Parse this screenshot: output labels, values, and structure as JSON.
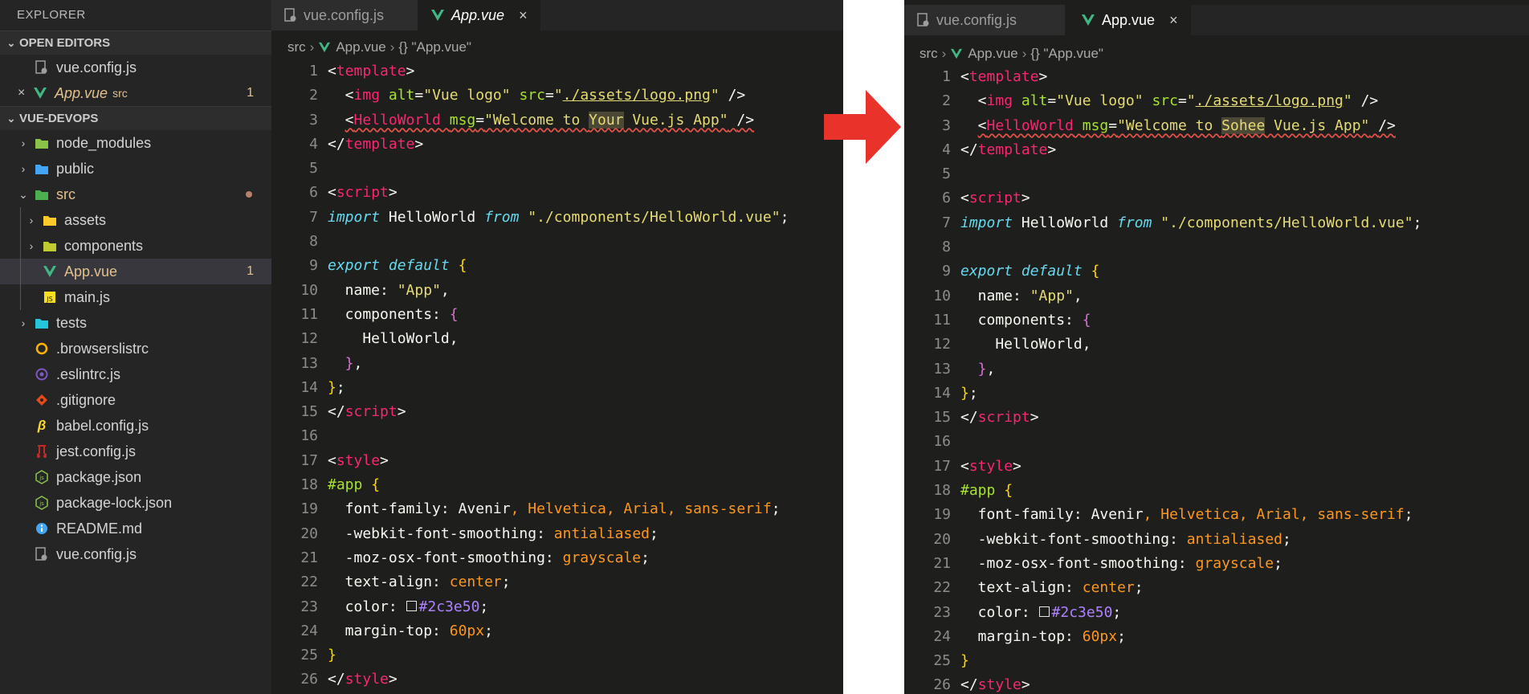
{
  "explorer": {
    "title": "EXPLORER",
    "open_editors": {
      "label": "OPEN EDITORS",
      "items": [
        {
          "name": "vue.config.js",
          "icon": "gear-file-icon"
        },
        {
          "name": "App.vue",
          "desc": "src",
          "badge": "1",
          "icon": "vue-icon"
        }
      ]
    },
    "project": {
      "label": "VUE-DEVOPS",
      "items": [
        {
          "name": "node_modules",
          "type": "folder",
          "color": "#8bc34a"
        },
        {
          "name": "public",
          "type": "folder",
          "color": "#42a5f5"
        },
        {
          "name": "src",
          "type": "folder",
          "color": "#4caf50"
        },
        {
          "name": "assets",
          "type": "folder",
          "color": "#ffca28"
        },
        {
          "name": "components",
          "type": "folder",
          "color": "#c0ca33"
        },
        {
          "name": "App.vue",
          "badge": "1"
        },
        {
          "name": "main.js"
        },
        {
          "name": "tests",
          "type": "folder",
          "color": "#26c6da"
        },
        {
          "name": ".browserslistrc"
        },
        {
          "name": ".eslintrc.js"
        },
        {
          "name": ".gitignore"
        },
        {
          "name": "babel.config.js"
        },
        {
          "name": "jest.config.js"
        },
        {
          "name": "package.json"
        },
        {
          "name": "package-lock.json"
        },
        {
          "name": "README.md"
        },
        {
          "name": "vue.config.js"
        }
      ]
    }
  },
  "left_editor": {
    "tabs": [
      {
        "label": "vue.config.js"
      },
      {
        "label": "App.vue",
        "close": "×"
      }
    ],
    "breadcrumb": [
      "src",
      "App.vue",
      "{} \"App.vue\""
    ],
    "welcome_word": "Your"
  },
  "right_editor": {
    "tabs": [
      {
        "label": "vue.config.js"
      },
      {
        "label": "App.vue",
        "close": "×"
      }
    ],
    "breadcrumb": [
      "src",
      "App.vue",
      "{} \"App.vue\""
    ],
    "welcome_word": "Sohee"
  },
  "code": {
    "line_numbers": [
      "1",
      "2",
      "3",
      "4",
      "5",
      "6",
      "7",
      "8",
      "9",
      "10",
      "11",
      "12",
      "13",
      "14",
      "15",
      "16",
      "17",
      "18",
      "19",
      "20",
      "21",
      "22",
      "23",
      "24",
      "25",
      "26"
    ],
    "template_open": "template",
    "img_tag": "img",
    "img_alt_attr": "alt",
    "img_alt_val": "\"Vue logo\"",
    "img_src_attr": "src",
    "img_src_val": "./assets/logo.png",
    "hello_tag": "HelloWorld",
    "msg_attr": "msg",
    "msg_before": "\"Welcome to ",
    "msg_after": " Vue.js App\"",
    "script_tag": "script",
    "import_kw": "import",
    "import_name": "HelloWorld",
    "from_kw": "from",
    "import_path": "\"./components/HelloWorld.vue\"",
    "export_kw": "export default",
    "name_prop": "name",
    "name_val": "\"App\"",
    "components_prop": "components",
    "hello_ref": "HelloWorld,",
    "style_tag": "style",
    "selector": "#app",
    "css": [
      {
        "prop": "font-family",
        "value_plain": "Avenir",
        "value_rest": ", Helvetica, Arial, sans-serif"
      },
      {
        "prop": "-webkit-font-smoothing",
        "value": "antialiased"
      },
      {
        "prop": "-moz-osx-font-smoothing",
        "value": "grayscale"
      },
      {
        "prop": "text-align",
        "value": "center"
      },
      {
        "prop": "color",
        "value": "#2c3e50"
      },
      {
        "prop": "margin-top",
        "value": "60px"
      }
    ]
  }
}
